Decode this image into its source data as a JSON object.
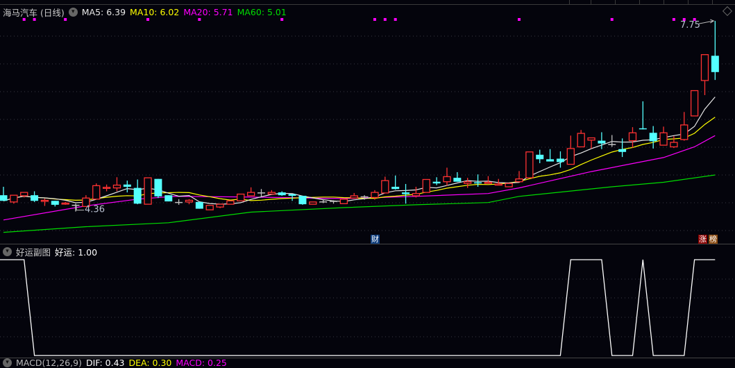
{
  "header": {
    "title": "海马汽车 (日线)",
    "ma": [
      {
        "label": "MA5: 6.39",
        "color": "#e8e8e8"
      },
      {
        "label": "MA10: 6.02",
        "color": "#ffff00"
      },
      {
        "label": "MA20: 5.71",
        "color": "#ff00ff"
      },
      {
        "label": "MA60: 5.01",
        "color": "#00dd00"
      }
    ]
  },
  "subpanel": {
    "title": "好运副图",
    "value_label": "好运: 1.00"
  },
  "macd_panel": {
    "title": "MACD(12,26,9)",
    "dif": "DIF: 0.43",
    "dea": "DEA: 0.30",
    "macd": "MACD: 0.25"
  },
  "annotations": {
    "high_label": "7.75",
    "low_label": "4.36",
    "cai": "财",
    "zhang": "涨",
    "bang": "榜"
  },
  "colors": {
    "up": "#ff3232",
    "down": "#54ffff",
    "flat": "#c0c0c0",
    "ma5": "#e8e8e8",
    "ma10": "#ffff00",
    "ma20": "#ff00ff",
    "ma60": "#00dd00",
    "signal_dot": "#ff00ff",
    "haoyun_line": "#ffffff"
  },
  "chart_data": {
    "type": "candlestick",
    "ylim": [
      3.8,
      7.85
    ],
    "grid": true,
    "ohlc_fields": [
      "open",
      "high",
      "low",
      "close"
    ],
    "candles": [
      [
        4.65,
        4.8,
        4.55,
        4.55
      ],
      [
        4.53,
        4.65,
        4.5,
        4.65
      ],
      [
        4.64,
        4.7,
        4.61,
        4.7
      ],
      [
        4.65,
        4.72,
        4.53,
        4.55
      ],
      [
        4.55,
        4.59,
        4.46,
        4.56
      ],
      [
        4.55,
        4.55,
        4.45,
        4.48
      ],
      [
        4.5,
        4.53,
        4.48,
        4.51
      ],
      [
        4.48,
        4.5,
        4.36,
        4.48
      ],
      [
        4.45,
        4.65,
        4.45,
        4.6
      ],
      [
        4.58,
        4.86,
        4.58,
        4.82
      ],
      [
        4.78,
        4.84,
        4.72,
        4.79
      ],
      [
        4.78,
        4.97,
        4.72,
        4.83
      ],
      [
        4.84,
        4.91,
        4.7,
        4.8
      ],
      [
        4.78,
        4.93,
        4.49,
        4.5
      ],
      [
        4.49,
        4.96,
        4.49,
        4.96
      ],
      [
        4.94,
        4.94,
        4.6,
        4.63
      ],
      [
        4.65,
        4.65,
        4.54,
        4.54
      ],
      [
        4.53,
        4.58,
        4.48,
        4.53
      ],
      [
        4.53,
        4.58,
        4.49,
        4.56
      ],
      [
        4.53,
        4.53,
        4.41,
        4.41
      ],
      [
        4.39,
        4.47,
        4.39,
        4.47
      ],
      [
        4.44,
        4.49,
        4.42,
        4.49
      ],
      [
        4.49,
        4.55,
        4.49,
        4.55
      ],
      [
        4.55,
        4.67,
        4.55,
        4.67
      ],
      [
        4.64,
        4.79,
        4.64,
        4.7
      ],
      [
        4.7,
        4.76,
        4.63,
        4.7
      ],
      [
        4.67,
        4.74,
        4.67,
        4.7
      ],
      [
        4.7,
        4.72,
        4.64,
        4.65
      ],
      [
        4.67,
        4.67,
        4.55,
        4.64
      ],
      [
        4.64,
        4.64,
        4.48,
        4.49
      ],
      [
        4.49,
        4.53,
        4.49,
        4.53
      ],
      [
        4.54,
        4.58,
        4.51,
        4.54
      ],
      [
        4.55,
        4.56,
        4.5,
        4.55
      ],
      [
        4.5,
        4.58,
        4.5,
        4.58
      ],
      [
        4.6,
        4.69,
        4.6,
        4.64
      ],
      [
        4.63,
        4.65,
        4.57,
        4.63
      ],
      [
        4.61,
        4.74,
        4.57,
        4.7
      ],
      [
        4.69,
        4.98,
        4.69,
        4.91
      ],
      [
        4.8,
        5.0,
        4.75,
        4.76
      ],
      [
        4.7,
        4.85,
        4.5,
        4.67
      ],
      [
        4.64,
        4.8,
        4.61,
        4.68
      ],
      [
        4.7,
        4.93,
        4.7,
        4.93
      ],
      [
        4.89,
        4.97,
        4.83,
        4.86
      ],
      [
        4.89,
        5.14,
        4.82,
        4.98
      ],
      [
        4.96,
        5.06,
        4.89,
        4.89
      ],
      [
        4.86,
        4.96,
        4.78,
        4.89
      ],
      [
        4.88,
        5.02,
        4.8,
        4.86
      ],
      [
        4.86,
        4.99,
        4.86,
        4.88
      ],
      [
        4.83,
        4.94,
        4.83,
        4.85
      ],
      [
        4.8,
        4.86,
        4.8,
        4.86
      ],
      [
        4.89,
        5.08,
        4.88,
        4.94
      ],
      [
        4.96,
        5.42,
        4.96,
        5.42
      ],
      [
        5.37,
        5.46,
        5.22,
        5.29
      ],
      [
        5.29,
        5.47,
        5.25,
        5.25
      ],
      [
        5.3,
        5.43,
        5.14,
        5.24
      ],
      [
        5.2,
        5.71,
        5.2,
        5.48
      ],
      [
        5.51,
        5.81,
        5.51,
        5.75
      ],
      [
        5.63,
        5.67,
        5.48,
        5.67
      ],
      [
        5.62,
        5.77,
        5.47,
        5.57
      ],
      [
        5.56,
        5.72,
        5.51,
        5.56
      ],
      [
        5.47,
        5.66,
        5.33,
        5.42
      ],
      [
        5.62,
        5.86,
        5.49,
        5.76
      ],
      [
        5.84,
        6.32,
        5.82,
        5.83
      ],
      [
        5.76,
        5.88,
        5.48,
        5.61
      ],
      [
        5.54,
        5.87,
        5.54,
        5.76
      ],
      [
        5.51,
        5.7,
        5.49,
        5.59
      ],
      [
        5.64,
        6.13,
        5.62,
        5.9
      ],
      [
        6.06,
        6.51,
        6.06,
        6.51
      ],
      [
        6.69,
        7.15,
        6.43,
        7.15
      ],
      [
        7.13,
        7.75,
        6.7,
        6.84
      ]
    ],
    "ma20_points": [
      [
        0,
        4.21
      ],
      [
        8,
        4.46
      ],
      [
        13,
        4.58
      ],
      [
        16.5,
        4.63
      ],
      [
        23,
        4.62
      ],
      [
        33,
        4.59
      ],
      [
        40,
        4.63
      ],
      [
        47,
        4.68
      ],
      [
        50,
        4.78
      ],
      [
        57,
        5.07
      ],
      [
        64,
        5.32
      ],
      [
        67,
        5.51
      ],
      [
        69,
        5.71
      ]
    ],
    "ma60_points": [
      [
        0,
        3.99
      ],
      [
        8,
        4.09
      ],
      [
        16,
        4.16
      ],
      [
        24,
        4.35
      ],
      [
        33,
        4.43
      ],
      [
        40,
        4.48
      ],
      [
        47,
        4.52
      ],
      [
        50,
        4.63
      ],
      [
        59,
        4.8
      ],
      [
        64,
        4.88
      ],
      [
        69,
        5.01
      ]
    ],
    "signal_dots": [
      2,
      3,
      6,
      14,
      19,
      27,
      36,
      37,
      38,
      50,
      59,
      65,
      66,
      67
    ],
    "high": {
      "index": 69,
      "value": 7.75
    },
    "low": {
      "index": 7,
      "value": 4.36
    },
    "cai_index": 36,
    "haoyun": [
      1,
      1,
      1,
      0,
      0,
      0,
      0,
      0,
      0,
      0,
      0,
      0,
      0,
      0,
      0,
      0,
      0,
      0,
      0,
      0,
      0,
      0,
      0,
      0,
      0,
      0,
      0,
      0,
      0,
      0,
      0,
      0,
      0,
      0,
      0,
      0,
      0,
      0,
      0,
      0,
      0,
      0,
      0,
      0,
      0,
      0,
      0,
      0,
      0,
      0,
      0,
      0,
      0,
      0,
      0,
      1,
      1,
      1,
      1,
      0,
      0,
      0,
      1,
      0,
      0,
      0,
      0,
      1,
      1,
      1
    ],
    "haoyun_ylim": [
      0,
      1
    ]
  }
}
